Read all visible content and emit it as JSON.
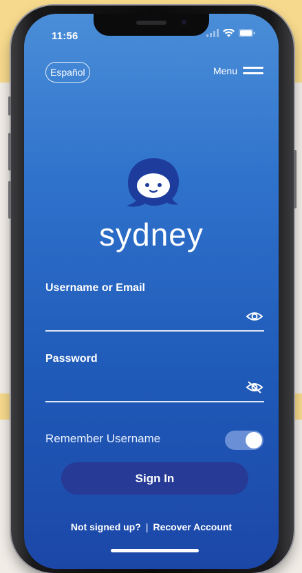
{
  "status_bar": {
    "time": "11:56"
  },
  "header": {
    "language_label": "Español",
    "menu_label": "Menu"
  },
  "logo": {
    "wordmark": "sydney"
  },
  "form": {
    "username_label": "Username or Email",
    "username_value": "",
    "password_label": "Password",
    "password_value": "",
    "remember_label": "Remember Username",
    "remember_on": true,
    "signin_label": "Sign In"
  },
  "footer": {
    "not_signed_up": "Not signed up?",
    "separator": "|",
    "recover": "Recover Account"
  },
  "colors": {
    "screen_top": "#4a8ed8",
    "screen_bottom": "#1c47a8",
    "button": "#263a96",
    "toggle": "#6a8fd6"
  },
  "icons": [
    "signal-icon",
    "wifi-icon",
    "battery-icon",
    "hamburger-icon",
    "chat-bubble-logo-icon",
    "eye-icon",
    "eye-off-icon"
  ]
}
